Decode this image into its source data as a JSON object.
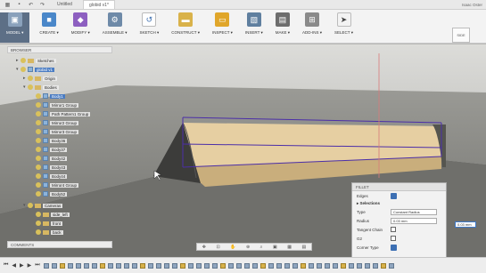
{
  "titlebar": {
    "doc_tab": "globid v1*",
    "left_tab": "Untitled",
    "user": "Isaac Oster"
  },
  "toolbar": {
    "items": [
      {
        "label": "MODEL ▾"
      },
      {
        "label": "CREATE ▾"
      },
      {
        "label": "MODIFY ▾"
      },
      {
        "label": "ASSEMBLE ▾"
      },
      {
        "label": "SKETCH ▾"
      },
      {
        "label": "CONSTRUCT ▾"
      },
      {
        "label": "INSPECT ▾"
      },
      {
        "label": "INSERT ▾"
      },
      {
        "label": "MAKE ▾"
      },
      {
        "label": "ADD-INS ▾"
      },
      {
        "label": "SELECT ▾"
      }
    ]
  },
  "browser": {
    "title": "BROWSER",
    "rows": [
      {
        "name": "Sketches"
      },
      {
        "name": "globid v1"
      },
      {
        "name": "Origin"
      },
      {
        "name": "Bodies"
      },
      {
        "name": "Body1"
      },
      {
        "name": "Mirror1 Group"
      },
      {
        "name": "Path Pattern1 Group"
      },
      {
        "name": "Mirror2 Group"
      },
      {
        "name": "Mirror3 Group"
      },
      {
        "name": "Body36"
      },
      {
        "name": "Body37"
      },
      {
        "name": "Body42"
      },
      {
        "name": "Body43"
      },
      {
        "name": "Body44"
      },
      {
        "name": "Mirror4 Group"
      },
      {
        "name": "Body52"
      },
      {
        "name": "Cameras"
      },
      {
        "name": "side_left"
      },
      {
        "name": "front"
      },
      {
        "name": "back"
      }
    ]
  },
  "viewcube": {
    "label": "SIDE"
  },
  "fillet": {
    "title": "FILLET",
    "edges_label": "Edges",
    "selections_label": "▸ Selections",
    "type_label": "Type",
    "type_value": "Constant Radius",
    "radius_label": "Radius",
    "radius_value": "0.03 mm",
    "tangent_label": "Tangent Chain",
    "g2_label": "G2",
    "corner_label": "Corner Type"
  },
  "radius_field": "0.03 mm",
  "comments": {
    "label": "COMMENTS"
  },
  "navbar": {
    "icons": [
      "✥",
      "⊡",
      "✋",
      "⊕",
      "⌕",
      "▣",
      "▦",
      "▤"
    ]
  },
  "timeline": {
    "controls": [
      "⏮",
      "◀",
      "▶",
      "▶",
      "⏭"
    ]
  }
}
